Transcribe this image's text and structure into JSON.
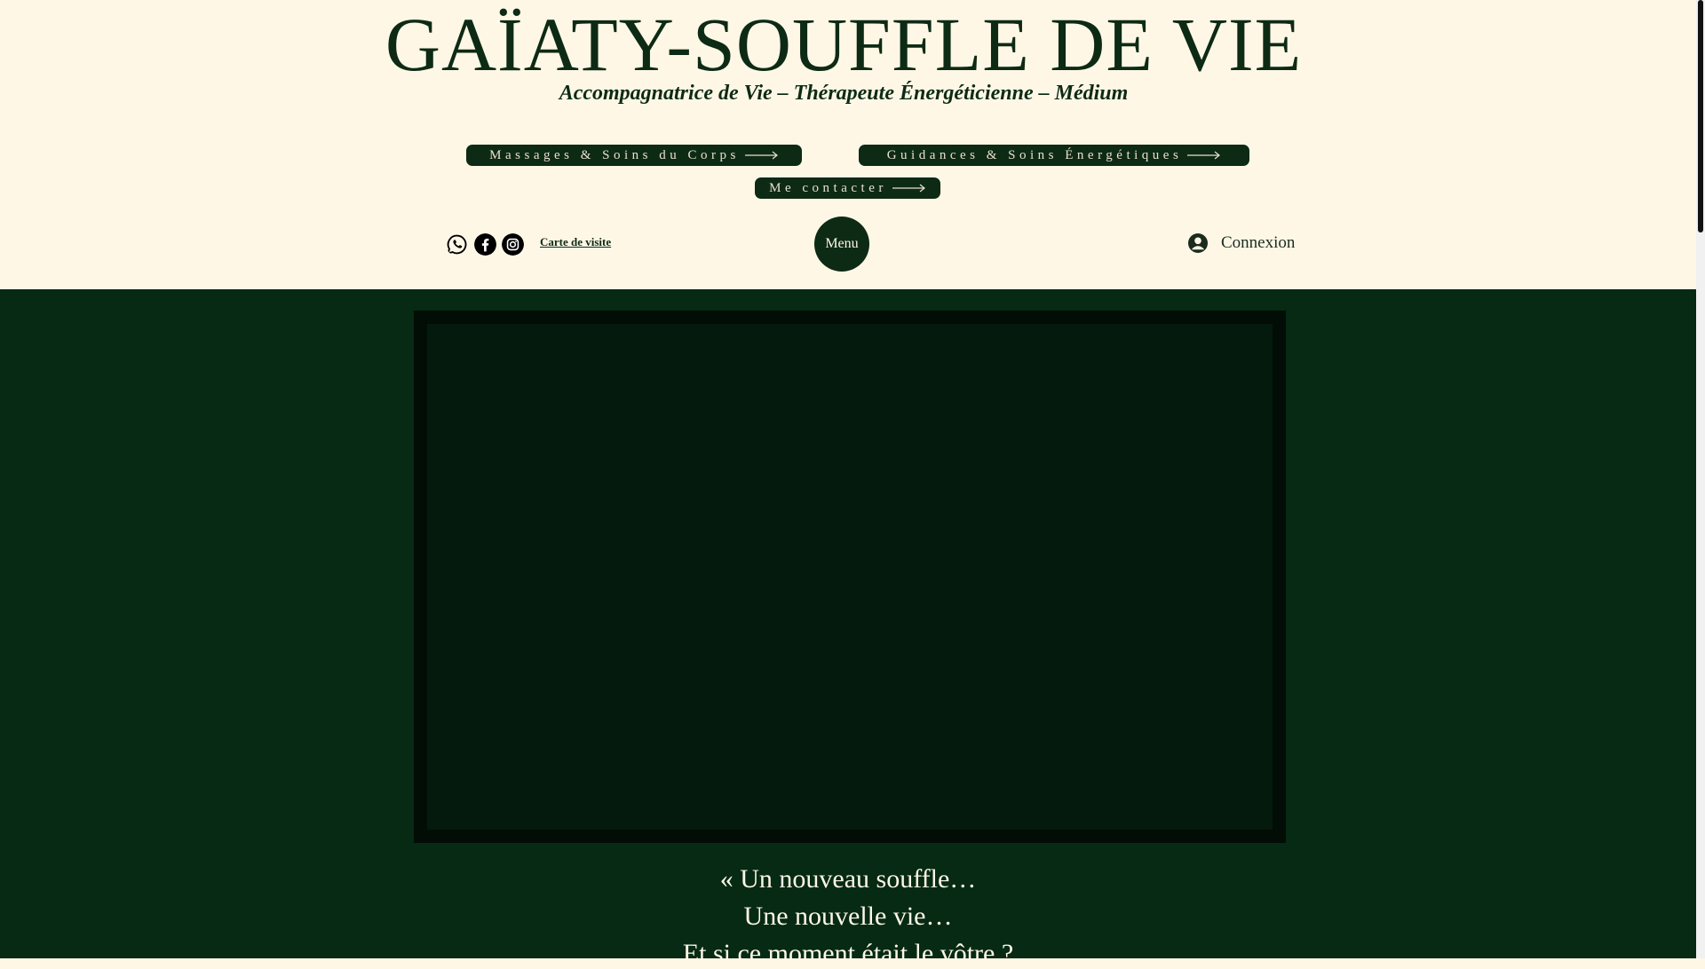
{
  "header": {
    "title": "GAÏATY-SOUFFLE DE VIE",
    "tagline": "Accompagnatrice de Vie – Thérapeute Énergéticienne – Médium",
    "nav_buttons": [
      {
        "label": "Massages & Soins du Corps"
      },
      {
        "label": "Guidances & Soins Énergétiques"
      },
      {
        "label": "Me contacter"
      }
    ],
    "social_icons": [
      "whatsapp-icon",
      "facebook-icon",
      "instagram-icon"
    ],
    "business_card_link": "Carte de visite",
    "menu_label": "Menu",
    "login_label": "Connexion"
  },
  "main": {
    "quote_lines": [
      "« Un nouveau souffle…",
      "Une nouvelle vie…",
      "Et si ce moment était le vôtre ?"
    ]
  },
  "colors": {
    "background": "#fef7e6",
    "accent": "#0d2a14",
    "section_bg": "#062a14"
  }
}
